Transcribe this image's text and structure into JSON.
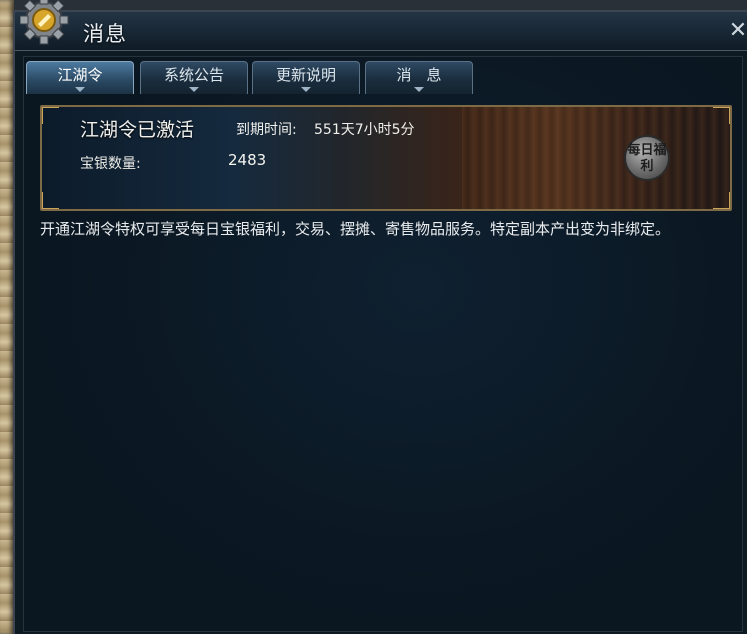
{
  "window": {
    "title": "消息",
    "close_glyph": "✕"
  },
  "tabs": [
    {
      "label": "江湖令",
      "active": true
    },
    {
      "label": "系统公告",
      "active": false
    },
    {
      "label": "更新说明",
      "active": false
    },
    {
      "label": "消　息",
      "active": false
    }
  ],
  "banner": {
    "status": "江湖令已激活",
    "expiry_label": "到期时间:",
    "expiry_value": "551天7小时5分",
    "silver_label": "宝银数量:",
    "silver_value": "2483",
    "seal_text": "每日福利"
  },
  "description": "开通江湖令特权可享受每日宝银福利，交易、摆摊、寄售物品服务。特定副本产出变为非绑定。",
  "icons": {
    "logo": "gear-logo-icon",
    "close": "close-icon",
    "tab_indicator": "chevron-down-icon"
  },
  "colors": {
    "accent_gold": "#c8a55a",
    "tab_active": "#4d7aa0",
    "panel_bg": "#0d1a22"
  }
}
